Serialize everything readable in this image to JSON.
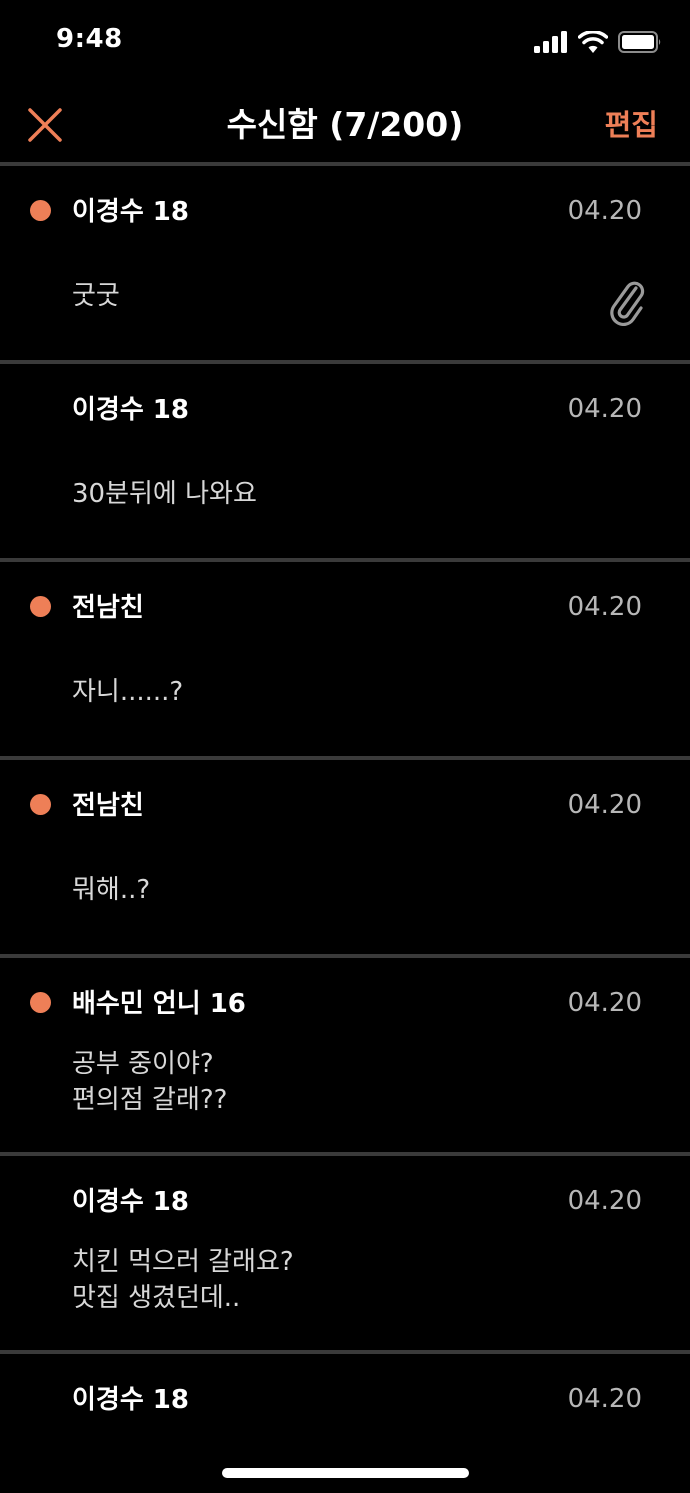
{
  "status_bar": {
    "time": "9:48"
  },
  "nav": {
    "title": "수신함 (7/200)",
    "edit_label": "편집",
    "accent_color": "#ee7f57"
  },
  "messages": [
    {
      "sender": "이경수 18",
      "date": "04.20",
      "unread": true,
      "attachment": true,
      "preview": [
        "굿굿"
      ]
    },
    {
      "sender": "이경수 18",
      "date": "04.20",
      "unread": false,
      "attachment": false,
      "preview": [
        "30분뒤에 나와요"
      ]
    },
    {
      "sender": "전남친",
      "date": "04.20",
      "unread": true,
      "attachment": false,
      "preview": [
        "자니......?"
      ]
    },
    {
      "sender": "전남친",
      "date": "04.20",
      "unread": true,
      "attachment": false,
      "preview": [
        "뭐해..?"
      ]
    },
    {
      "sender": "배수민 언니 16",
      "date": "04.20",
      "unread": true,
      "attachment": false,
      "preview": [
        "공부 중이야?",
        "편의점 갈래??"
      ]
    },
    {
      "sender": "이경수 18",
      "date": "04.20",
      "unread": false,
      "attachment": false,
      "preview": [
        "치킨 먹으러 갈래요?",
        "맛집 생겼던데.."
      ]
    },
    {
      "sender": "이경수 18",
      "date": "04.20",
      "unread": false,
      "attachment": false,
      "preview": []
    }
  ]
}
